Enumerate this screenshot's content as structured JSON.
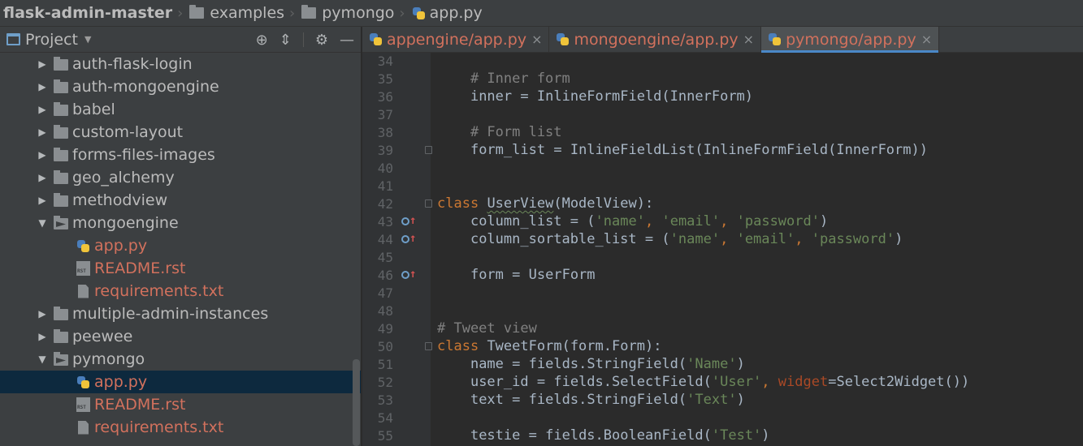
{
  "breadcrumb": {
    "root": "flask-admin-master",
    "items": [
      "examples",
      "pymongo",
      "app.py"
    ]
  },
  "project_panel": {
    "title": "Project",
    "tree": [
      {
        "type": "dir",
        "label": "auth-flask-login",
        "expanded": false,
        "indent": 0
      },
      {
        "type": "dir",
        "label": "auth-mongoengine",
        "expanded": false,
        "indent": 0
      },
      {
        "type": "dir",
        "label": "babel",
        "expanded": false,
        "indent": 0
      },
      {
        "type": "dir",
        "label": "custom-layout",
        "expanded": false,
        "indent": 0
      },
      {
        "type": "dir",
        "label": "forms-files-images",
        "expanded": false,
        "indent": 0
      },
      {
        "type": "dir",
        "label": "geo_alchemy",
        "expanded": false,
        "indent": 0
      },
      {
        "type": "dir",
        "label": "methodview",
        "expanded": false,
        "indent": 0
      },
      {
        "type": "dir",
        "label": "mongoengine",
        "expanded": true,
        "indent": 0
      },
      {
        "type": "py",
        "label": "app.py",
        "indent": 1
      },
      {
        "type": "rst",
        "label": "README.rst",
        "indent": 1
      },
      {
        "type": "txt",
        "label": "requirements.txt",
        "indent": 1
      },
      {
        "type": "dir",
        "label": "multiple-admin-instances",
        "expanded": false,
        "indent": 0
      },
      {
        "type": "dir",
        "label": "peewee",
        "expanded": false,
        "indent": 0
      },
      {
        "type": "dir",
        "label": "pymongo",
        "expanded": true,
        "indent": 0
      },
      {
        "type": "py",
        "label": "app.py",
        "indent": 1,
        "selected": true
      },
      {
        "type": "rst",
        "label": "README.rst",
        "indent": 1
      },
      {
        "type": "txt",
        "label": "requirements.txt",
        "indent": 1
      }
    ]
  },
  "editor": {
    "tabs": [
      {
        "label": "appengine/app.py",
        "active": false
      },
      {
        "label": "mongoengine/app.py",
        "active": false
      },
      {
        "label": "pymongo/app.py",
        "active": true
      }
    ],
    "lines": [
      {
        "n": "34",
        "code": ""
      },
      {
        "n": "35",
        "code": "    # Inner form"
      },
      {
        "n": "36",
        "code": "    inner = InlineFormField(InnerForm)"
      },
      {
        "n": "37",
        "code": ""
      },
      {
        "n": "38",
        "code": "    # Form list"
      },
      {
        "n": "39",
        "code": "    form_list = InlineFieldList(InlineFormField(InnerForm))"
      },
      {
        "n": "40",
        "code": ""
      },
      {
        "n": "41",
        "code": ""
      },
      {
        "n": "42",
        "code": "class UserView(ModelView):"
      },
      {
        "n": "43",
        "code": "    column_list = ('name', 'email', 'password')"
      },
      {
        "n": "44",
        "code": "    column_sortable_list = ('name', 'email', 'password')"
      },
      {
        "n": "45",
        "code": ""
      },
      {
        "n": "46",
        "code": "    form = UserForm"
      },
      {
        "n": "47",
        "code": ""
      },
      {
        "n": "48",
        "code": ""
      },
      {
        "n": "49",
        "code": "# Tweet view"
      },
      {
        "n": "50",
        "code": "class TweetForm(form.Form):"
      },
      {
        "n": "51",
        "code": "    name = fields.StringField('Name')"
      },
      {
        "n": "52",
        "code": "    user_id = fields.SelectField('User', widget=Select2Widget())"
      },
      {
        "n": "53",
        "code": "    text = fields.StringField('Text')"
      },
      {
        "n": "54",
        "code": ""
      },
      {
        "n": "55",
        "code": "    testie = fields.BooleanField('Test')"
      }
    ]
  },
  "colors": {
    "keyword": "#cc7832",
    "comment": "#808080",
    "string": "#6a8759",
    "changed_file": "#d2715d",
    "selection": "#0d293e"
  }
}
